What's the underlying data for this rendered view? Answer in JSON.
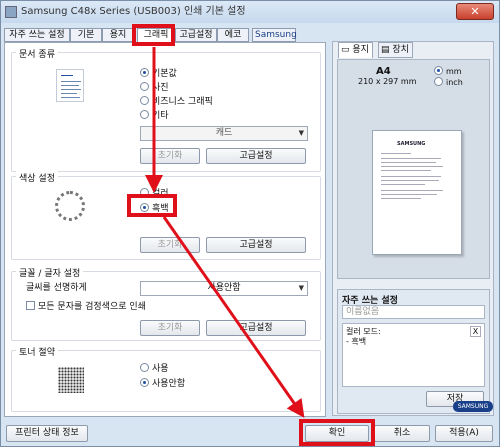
{
  "window": {
    "title": "Samsung C48x Series (USB003) 인쇄 기본 설정",
    "close_symbol": "✕"
  },
  "tabs": [
    {
      "label": "자주 쓰는 설정"
    },
    {
      "label": "기본"
    },
    {
      "label": "용지"
    },
    {
      "label": "그래픽"
    },
    {
      "label": "고급설정"
    },
    {
      "label": "에코"
    },
    {
      "label": "Samsung"
    }
  ],
  "doc_type": {
    "label": "문서 종류",
    "options": [
      "기본값",
      "사진",
      "비즈니스 그래픽",
      "기타"
    ],
    "selected": "기본값",
    "combo_value": "캐드",
    "reset_label": "초기화",
    "advanced_label": "고급설정"
  },
  "color": {
    "label": "색상 설정",
    "options": [
      "컬러",
      "흑백"
    ],
    "selected": "흑백",
    "reset_label": "초기화",
    "advanced_label": "고급설정"
  },
  "font": {
    "label": "글꼴 / 글자 설정",
    "sharpen_label": "글씨를 선명하게",
    "sharpen_value": "사용안함",
    "black_text_label": "모든 문자를 검정색으로 인쇄",
    "reset_label": "초기화",
    "advanced_label": "고급설정"
  },
  "toner": {
    "label": "토너 절약",
    "options": [
      "사용",
      "사용안함"
    ],
    "selected": "사용안함"
  },
  "right_panel": {
    "tabs": [
      "용지",
      "장치"
    ],
    "paper_size": "A4",
    "paper_dims": "210 x 297 mm",
    "units": [
      "mm",
      "inch"
    ],
    "unit_selected": "mm",
    "page_brand": "SAMSUNG",
    "favorites_label": "자주 쓰는 설정",
    "favorites_placeholder": "이름없음",
    "detail_line1": "컬러 모드:",
    "detail_line2": "- 흑백",
    "detail_close": "X",
    "save_label": "저장",
    "brand_logo": "SAMSUNG"
  },
  "footer": {
    "printer_status": "프린터 상태 정보",
    "ok": "확인",
    "cancel": "취소",
    "apply": "적용(A)"
  },
  "annotation_color": "#e0101a"
}
